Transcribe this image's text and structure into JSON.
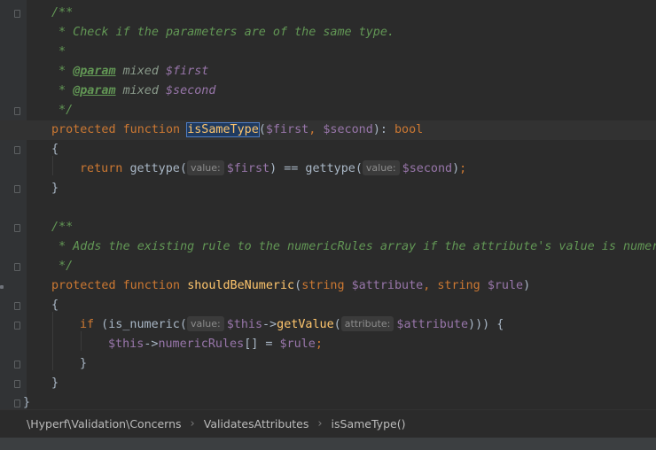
{
  "editor": {
    "line_1": "/**",
    "line_2": " * Check if the parameters are of the same type.",
    "line_3": " *",
    "line_4_tag": "@param",
    "line_4_type": "mixed",
    "line_4_var": "$first",
    "line_5_tag": "@param",
    "line_5_type": "mixed",
    "line_5_var": "$second",
    "line_6": " */",
    "line_7_kw1": "protected",
    "line_7_kw2": "function",
    "line_7_fn": "isSameType",
    "line_7_var1": "$first",
    "line_7_var2": "$second",
    "line_7_ret": "bool",
    "line_8": "{",
    "line_9_kw": "return",
    "line_9_fn1": "gettype",
    "line_9_hint1": "value:",
    "line_9_var1": "$first",
    "line_9_op": "==",
    "line_9_fn2": "gettype",
    "line_9_hint2": "value:",
    "line_9_var2": "$second",
    "line_10": "}",
    "line_12": "/**",
    "line_13": " * Adds the existing rule to the numericRules array if the attribute's value is numeric.",
    "line_14": " */",
    "line_15_kw1": "protected",
    "line_15_kw2": "function",
    "line_15_fn": "shouldBeNumeric",
    "line_15_type1": "string",
    "line_15_var1": "$attribute",
    "line_15_type2": "string",
    "line_15_var2": "$rule",
    "line_16": "{",
    "line_17_kw": "if",
    "line_17_fn1": "is_numeric",
    "line_17_hint1": "value:",
    "line_17_var1": "$this",
    "line_17_fn2": "getValue",
    "line_17_hint2": "attribute:",
    "line_17_var2": "$attribute",
    "line_18_var1": "$this",
    "line_18_prop": "numericRules",
    "line_18_var2": "$rule",
    "line_19": "}",
    "line_20": "}",
    "line_21": "}"
  },
  "breadcrumb": {
    "namespace": "\\Hyperf\\Validation\\Concerns",
    "class": "ValidatesAttributes",
    "method": "isSameType()"
  },
  "colors": {
    "background": "#2b2b2b",
    "keyword": "#cc7832",
    "function": "#ffc66d",
    "variable": "#9876aa",
    "doc_comment": "#629755",
    "text": "#a9b7c6"
  }
}
